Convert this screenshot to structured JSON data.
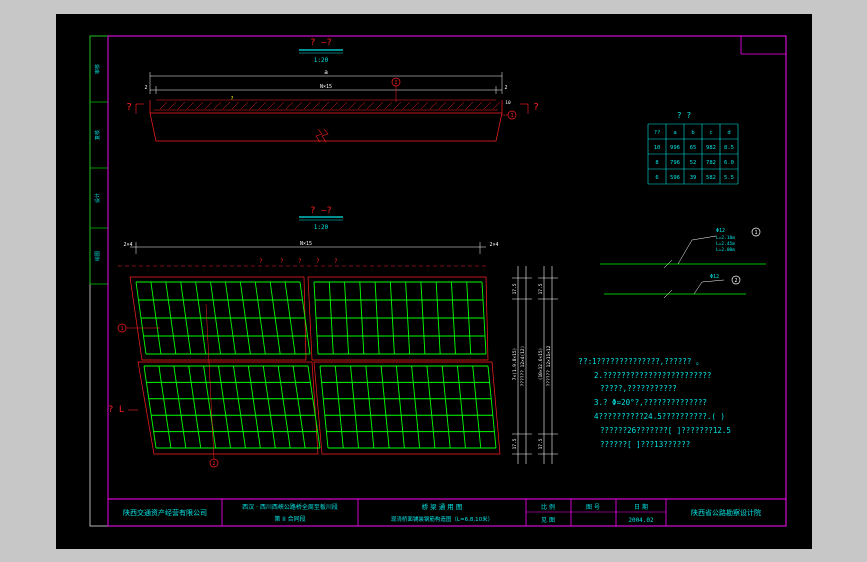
{
  "colors": {
    "frame": "#e0e0e0",
    "title_block": "#ff00ff",
    "text": "#00e5e5",
    "dim": "#ffffff",
    "rebar": "#00ff00",
    "leader": "#ff2020",
    "sidebar": "#00c000",
    "yellow": "#ffff00"
  },
  "side_labels": [
    "审核",
    "复核",
    "设计",
    "绘图"
  ],
  "section": {
    "title": "? —?",
    "scale": "1:20",
    "dim_total": "a",
    "dim_left": "2",
    "dim_right": "2",
    "dim_inner": "N×15",
    "callout_2": "2",
    "callout_1": "1",
    "tag_left": "?",
    "tag_right": "?",
    "small_left": "?",
    "small_mark": "?",
    "small_right": "10"
  },
  "plan": {
    "title": "? —?",
    "scale": "1:20",
    "dim_left": "2×4",
    "dim_right": "2×4",
    "dim_inner": "N×15",
    "top_marks": [
      "?",
      "?",
      "?",
      "?",
      "?"
    ],
    "callout_1": "1",
    "callout_2": "2",
    "tag": "? L"
  },
  "vdims": {
    "left": [
      "17.5",
      "7×(1.9.8×15)",
      "?????? 12×4(12)",
      "17.5"
    ],
    "right": [
      "17.5",
      "(10×12.6×15)",
      "?????? 12×11×12",
      "17.5"
    ]
  },
  "table": {
    "title": "? ?",
    "headers": [
      "??",
      "a",
      "b",
      "c",
      "d"
    ],
    "rows": [
      [
        "10",
        "996",
        "65",
        "982",
        "8.5"
      ],
      [
        "8",
        "796",
        "52",
        "782",
        "6.0"
      ],
      [
        "6",
        "596",
        "39",
        "582",
        "5.5"
      ]
    ]
  },
  "details": {
    "bar1_label": "Φ12",
    "bar1_sub": [
      "L=2.10m",
      "L=2.45m",
      "L=2.00m"
    ],
    "bar1_callout": "1",
    "bar2_label": "Φ12",
    "bar2_callout": "2"
  },
  "notes": {
    "head": "??:",
    "lines": [
      "1??????????????,??????  。",
      "2.????????????????????????",
      "?????,???????????",
      "3.? Φ=20°?,??????????????",
      "4??????????24.5??????????.(  )",
      "??????26???????[   ]???????12.5",
      "??????[  ]???13??????"
    ]
  },
  "title_block": {
    "company": "陕西交通资产经营有限公司",
    "project_1": "西汉 · 西川西峡公路桥全周至板川段",
    "project_2": "第 II 合同段",
    "drawing_1": "桥 梁 通 用 图",
    "drawing_2": "现浇桥面铺装钢筋构造图（L=6,8,10米）",
    "scale_label": "比 例",
    "sheet_label": "图 号",
    "see_label": "见 图",
    "date_label": "日 期",
    "date": "2004.02",
    "institute": "陕西省公路勘察设计院"
  }
}
